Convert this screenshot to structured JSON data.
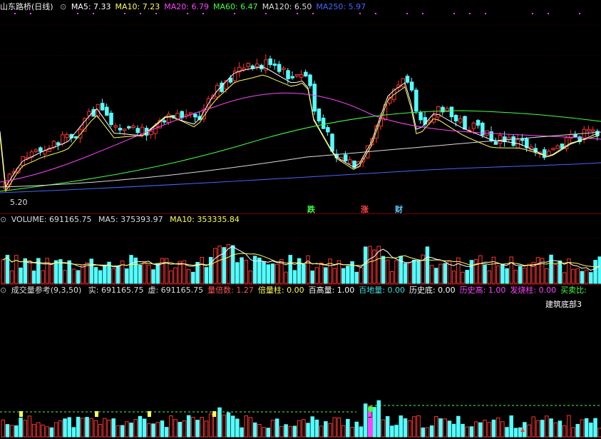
{
  "main": {
    "title": "山东路桥(日线)",
    "ma": [
      {
        "label": "MA5: 7.33",
        "color": "#ffffff"
      },
      {
        "label": "MA10: 7.23",
        "color": "#ffff55"
      },
      {
        "label": "MA20: 6.79",
        "color": "#ff44ff"
      },
      {
        "label": "MA60: 6.47",
        "color": "#44ff44"
      },
      {
        "label": "MA120: 6.50",
        "color": "#dddddd"
      },
      {
        "label": "MA250: 5.97",
        "color": "#4466ff"
      }
    ],
    "low_label": "5.20",
    "annotations": [
      {
        "text": "跌",
        "color": "#44ff44"
      },
      {
        "text": "涨",
        "color": "#ff4444"
      },
      {
        "text": "财",
        "color": "#55ccff"
      }
    ]
  },
  "volume": {
    "title": "VOLUME: 691165.75",
    "ma5": "MA5: 375393.97",
    "ma10": "MA10: 353335.84"
  },
  "indicator": {
    "title": "成交量参考(9,3,50)",
    "fields": [
      {
        "label": "实: 691165.75",
        "color": "#dddddd"
      },
      {
        "label": "虚: 691165.75",
        "color": "#dddddd"
      },
      {
        "label": "量倍数: 1.27",
        "color": "#ff5555"
      },
      {
        "label": "倍量柱: 0.00",
        "color": "#ffff55"
      },
      {
        "label": "百高量: 1.00",
        "color": "#ffffff"
      },
      {
        "label": "百地量: 0.00",
        "color": "#44dddd"
      },
      {
        "label": "历史底: 0.00",
        "color": "#ffffff"
      },
      {
        "label": "历史高: 1.00",
        "color": "#ff44ff"
      },
      {
        "label": "发烧柱: 0.00",
        "color": "#ff44ff"
      },
      {
        "label": "买卖比:",
        "color": "#44ff44"
      }
    ],
    "note": "建筑底部3"
  },
  "colors": {
    "up": "#ff3333",
    "down": "#55ffff",
    "bg": "#000000",
    "grid": "#5a0000"
  }
}
